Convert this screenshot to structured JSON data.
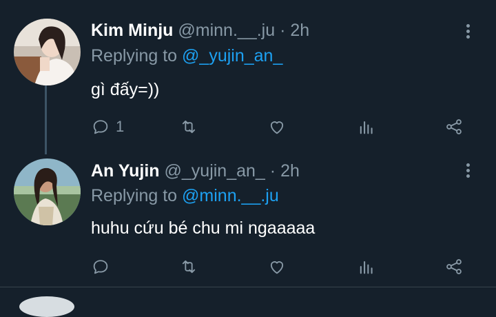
{
  "tweets": [
    {
      "name": "Kim Minju",
      "handle": "@minn.__.ju",
      "separator": "·",
      "time": "2h",
      "replying_prefix": "Replying to",
      "replying_to": "@_yujin_an_",
      "text": "gì đấy=))",
      "reply_count": "1",
      "avatar_icon": "profile-photo"
    },
    {
      "name": "An Yujin",
      "handle": "@_yujin_an_",
      "separator": "·",
      "time": "2h",
      "replying_prefix": "Replying to",
      "replying_to": "@minn.__.ju",
      "text": "huhu cứu bé chu mi ngaaaaa",
      "reply_count": "",
      "avatar_icon": "profile-photo"
    }
  ],
  "colors": {
    "background": "#15202b",
    "text_primary": "#ffffff",
    "text_secondary": "#8899a6",
    "link": "#1da1f2",
    "divider": "#38444d"
  },
  "action_icons": [
    "reply-icon",
    "retweet-icon",
    "like-icon",
    "analytics-icon",
    "share-icon"
  ]
}
